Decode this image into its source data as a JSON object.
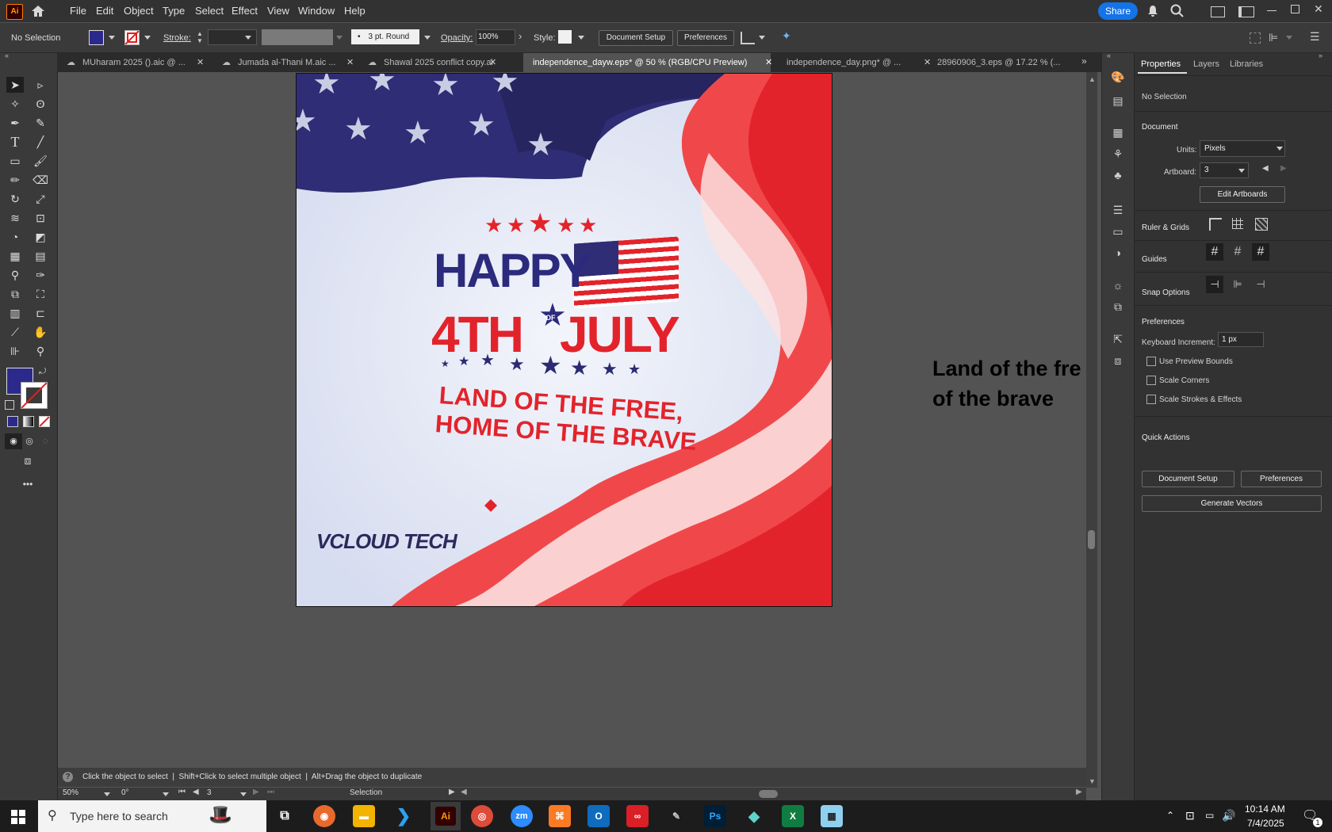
{
  "app": {
    "logo": "Ai"
  },
  "menu": [
    "File",
    "Edit",
    "Object",
    "Type",
    "Select",
    "Effect",
    "View",
    "Window",
    "Help"
  ],
  "share_label": "Share",
  "control": {
    "selection_state": "No Selection",
    "stroke_label": "Stroke:",
    "brush_value": "3 pt. Round",
    "opacity_label": "Opacity:",
    "opacity_value": "100%",
    "style_label": "Style:",
    "document_setup": "Document Setup",
    "preferences": "Preferences"
  },
  "tabs": [
    {
      "label": "MUharam 2025 ().aic @ ...",
      "active": false
    },
    {
      "label": "Jumada al-Thani M.aic ...",
      "active": false
    },
    {
      "label": "Shawal 2025 conflict copy.aic",
      "active": false
    },
    {
      "label": "independence_dayw.eps* @ 50 % (RGB/CPU Preview)",
      "active": true
    },
    {
      "label": "independence_day.png* @ ...",
      "active": false
    },
    {
      "label": "28960906_3.eps @ 17.22 % (...",
      "active": false
    }
  ],
  "artwork": {
    "happy": "HAPPY",
    "fourth": "4TH",
    "of": "OF",
    "july": "JULY",
    "line1": "LAND OF THE FREE,",
    "line2": "HOME OF THE BRAVE",
    "logo": "VCLOUD TECH"
  },
  "canvas_text": {
    "line1": "Land of the fre",
    "line2": "of the brave"
  },
  "status": {
    "hint": "Click the object to select  |  Shift+Click to select multiple object  |  Alt+Drag the object to duplicate",
    "zoom": "50%",
    "rotation": "0°",
    "artboard": "3",
    "tool": "Selection"
  },
  "properties": {
    "tabs": [
      "Properties",
      "Layers",
      "Libraries"
    ],
    "no_selection": "No Selection",
    "document": "Document",
    "units_label": "Units:",
    "units_value": "Pixels",
    "artboard_label": "Artboard:",
    "artboard_value": "3",
    "edit_artboards": "Edit Artboards",
    "ruler_grids": "Ruler & Grids",
    "guides": "Guides",
    "snap_options": "Snap Options",
    "preferences": "Preferences",
    "keyboard_increment_label": "Keyboard Increment:",
    "keyboard_increment_value": "1 px",
    "use_preview_bounds": "Use Preview Bounds",
    "scale_corners": "Scale Corners",
    "scale_strokes": "Scale Strokes & Effects",
    "quick_actions": "Quick Actions",
    "document_setup": "Document Setup",
    "preferences_btn": "Preferences",
    "generate_vectors": "Generate Vectors"
  },
  "taskbar": {
    "search_placeholder": "Type here to search",
    "time": "10:14 AM",
    "date": "7/4/2025",
    "notif_count": "1",
    "apps": [
      "Ai",
      "Ps"
    ]
  },
  "colors": {
    "fill": "#2b2a8c",
    "accent": "#1473e6",
    "flag_red": "#e3232b",
    "flag_blue": "#2b2a72"
  }
}
